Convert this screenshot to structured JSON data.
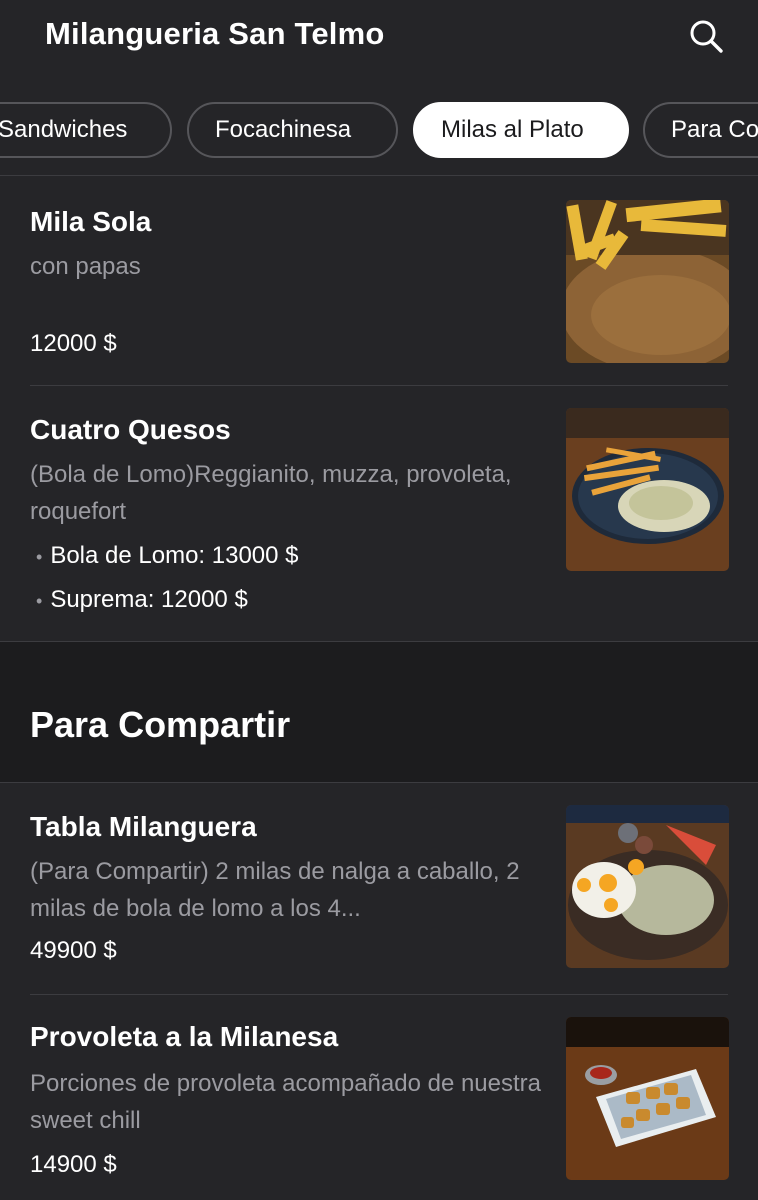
{
  "header": {
    "title": "Milangueria San Telmo",
    "search_icon": "search-icon"
  },
  "tabs": [
    {
      "label": "Sandwiches",
      "active": false
    },
    {
      "label": "Focachinesa",
      "active": false
    },
    {
      "label": "Milas al Plato",
      "active": true
    },
    {
      "label": "Para Compartir",
      "active": false
    }
  ],
  "items": [
    {
      "name": "Mila Sola",
      "description": "con papas",
      "price": "12000 $"
    },
    {
      "name": "Cuatro Quesos",
      "description": "(Bola de Lomo)Reggianito, muzza, provoleta, roquefort",
      "variants": [
        {
          "label": "Bola de Lomo: 13000 $"
        },
        {
          "label": "Suprema: 12000 $"
        }
      ]
    }
  ],
  "section": {
    "title": "Para Compartir",
    "items": [
      {
        "name": "Tabla Milanguera",
        "description": "(Para Compartir) 2 milas de nalga a caballo, 2 milas de bola de lomo a los 4...",
        "price": "49900 $"
      },
      {
        "name": "Provoleta a la Milanesa",
        "description": "Porciones de provoleta acompañado de nuestra sweet chill",
        "price": "14900 $"
      }
    ]
  }
}
